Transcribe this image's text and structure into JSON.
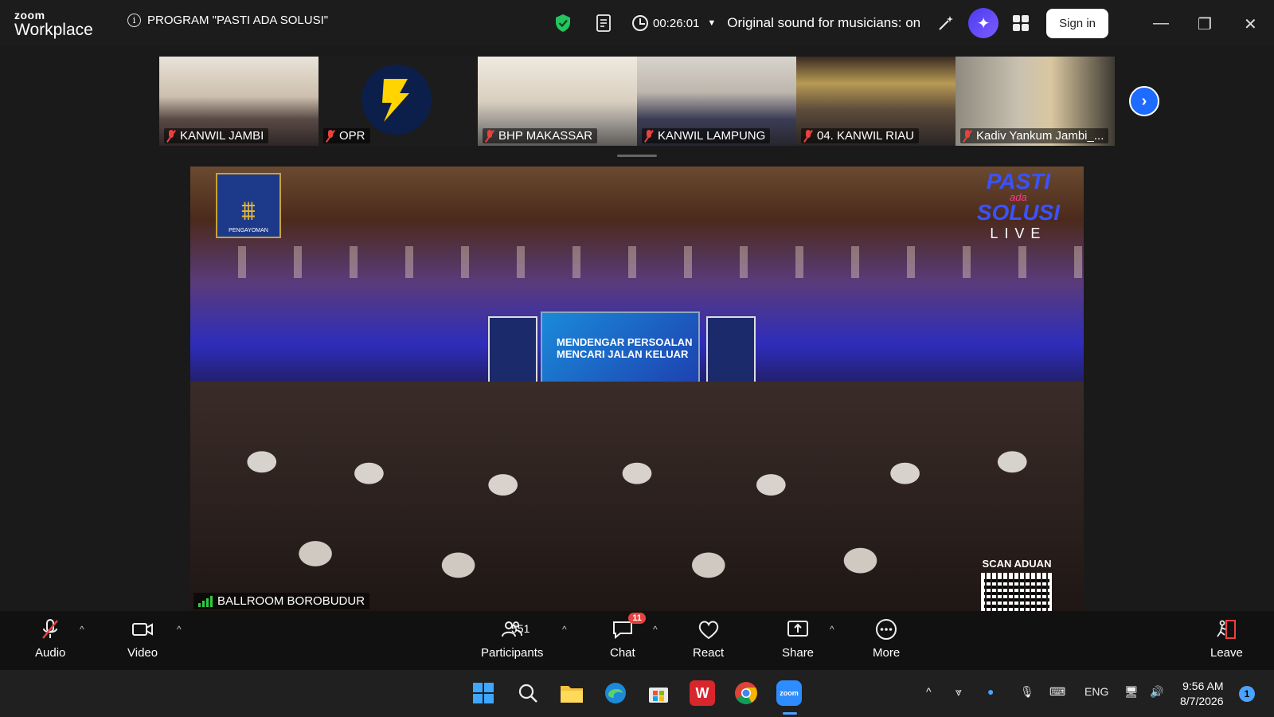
{
  "app": {
    "brand_small": "zoom",
    "brand_large": "Workplace"
  },
  "meeting": {
    "title": "PROGRAM \"PASTI ADA SOLUSI\"",
    "timer": "00:26:01",
    "sound_status": "Original sound for musicians: on",
    "sign_in_label": "Sign in"
  },
  "thumbnails": [
    {
      "name": "KANWIL JAMBI",
      "muted": true
    },
    {
      "name": "OPR",
      "muted": true
    },
    {
      "name": "BHP MAKASSAR",
      "muted": true
    },
    {
      "name": "KANWIL LAMPUNG",
      "muted": true
    },
    {
      "name": "04. KANWIL RIAU",
      "muted": true
    },
    {
      "name": "Kadiv Yankum Jambi_...",
      "muted": true
    }
  ],
  "main_video": {
    "speaker": "BALLROOM BOROBUDUR",
    "logo_text": "PENGAYOMAN",
    "overlay_line1": "PASTI",
    "overlay_line2": "ada",
    "overlay_line3": "SOLUSI",
    "overlay_live": "LIVE",
    "screen_text": "MENDENGAR PERSOALAN MENCARI JALAN KELUAR",
    "scan_label": "SCAN ADUAN"
  },
  "toolbar": {
    "audio": "Audio",
    "video": "Video",
    "participants": "Participants",
    "participants_count": "551",
    "chat": "Chat",
    "chat_badge": "11",
    "react": "React",
    "share": "Share",
    "more": "More",
    "leave": "Leave"
  },
  "taskbar": {
    "language": "ENG",
    "time": "9:56 AM",
    "date": "8/7/2026",
    "notifications": "1"
  },
  "colors": {
    "accent": "#1e6bff",
    "muted_red": "#e8423f",
    "leave_red": "#e8423f",
    "shield_green": "#22c55e"
  }
}
